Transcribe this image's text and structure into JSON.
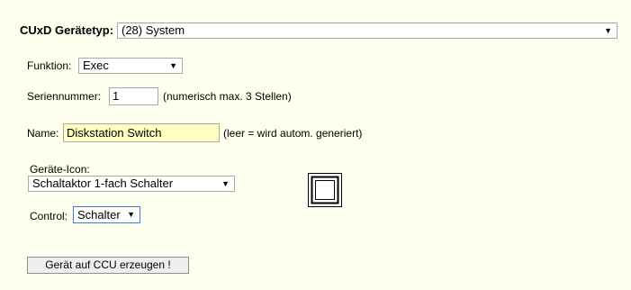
{
  "header": {
    "device_type_label": "CUxD Gerätetyp:",
    "device_type_value": "(28) System"
  },
  "function": {
    "label": "Funktion:",
    "value": "Exec"
  },
  "serial": {
    "label": "Seriennummer:",
    "value": "1",
    "hint": "(numerisch max. 3 Stellen)"
  },
  "name": {
    "label": "Name:",
    "value": "Diskstation Switch",
    "hint": "(leer = wird autom. generiert)"
  },
  "icon": {
    "label": "Geräte-Icon:",
    "value": "Schaltaktor 1-fach Schalter",
    "preview_icon": "switch-actuator-icon"
  },
  "control": {
    "label": "Control:",
    "value": "Schalter"
  },
  "create_button": {
    "label": "Gerät auf CCU erzeugen !"
  }
}
